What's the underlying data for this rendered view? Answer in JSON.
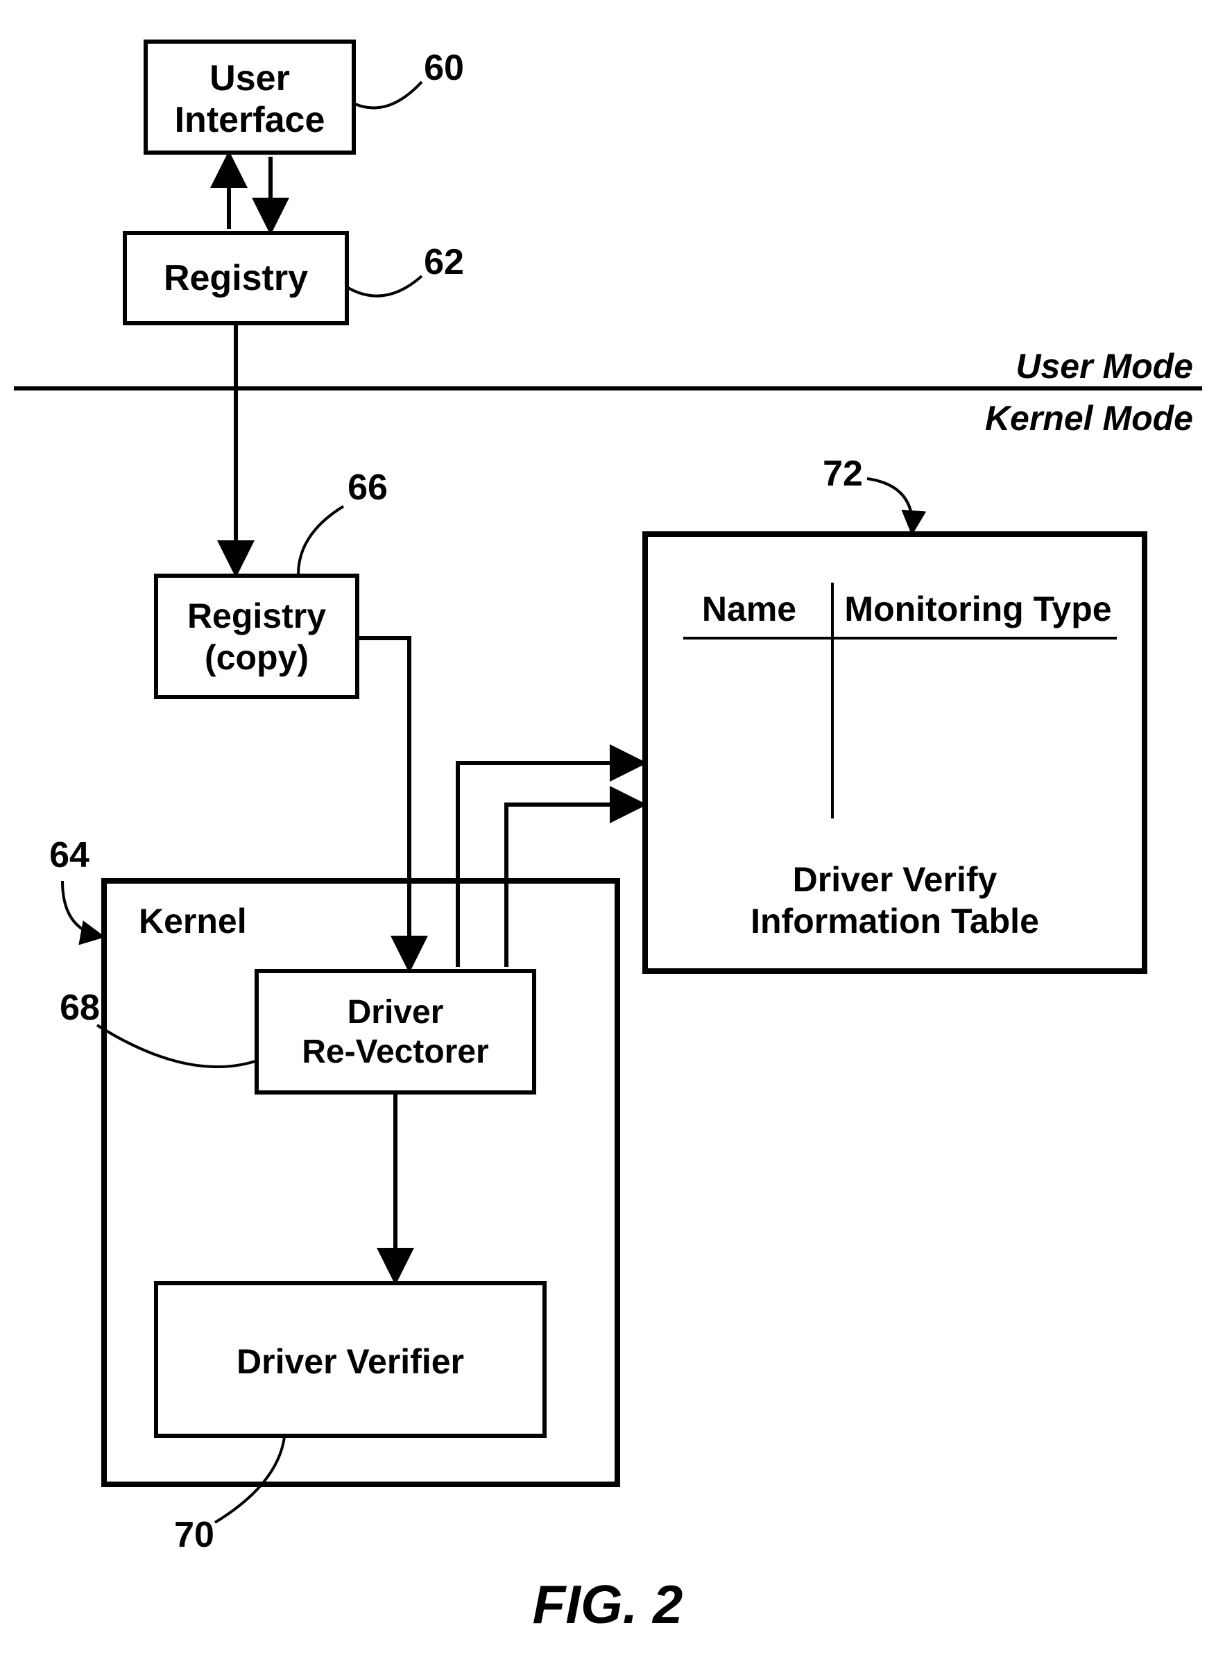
{
  "labels": {
    "ui1": "User",
    "ui2": "Interface",
    "reg": "Registry",
    "regc1": "Registry",
    "regc2": "(copy)",
    "kernel": "Kernel",
    "drv1": "Driver",
    "drv2": "Re-Vectorer",
    "ver": "Driver Verifier",
    "tblName": "Name",
    "tblMon": "Monitoring Type",
    "tblCap1": "Driver Verify",
    "tblCap2": "Information Table",
    "modeU": "User Mode",
    "modeK": "Kernel Mode",
    "fig": "FIG. 2"
  },
  "refs": {
    "r60": "60",
    "r62": "62",
    "r64": "64",
    "r66": "66",
    "r68": "68",
    "r70": "70",
    "r72": "72"
  }
}
